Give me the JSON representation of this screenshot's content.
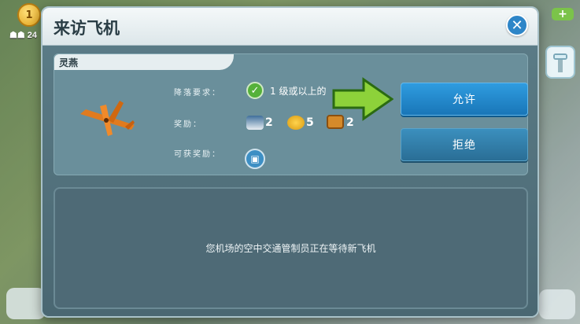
{
  "hud": {
    "level": "1",
    "people_count": "24",
    "plus_icon": "plus-icon"
  },
  "dialog": {
    "title": "来访飞机",
    "close_icon": "close-icon"
  },
  "request": {
    "plane_name": "灵燕",
    "landing_label": "降落要求：",
    "landing_requirement": "1 级或以上的",
    "reward_label": "奖励：",
    "rewards": [
      {
        "icon": "pilot-cap-icon",
        "value": "2"
      },
      {
        "icon": "coins-icon",
        "value": "5"
      },
      {
        "icon": "crate-icon",
        "value": "2"
      }
    ],
    "bonus_label": "可获奖励：",
    "bonus_icon": "gift-box-icon"
  },
  "actions": {
    "allow_label": "允许",
    "reject_label": "拒绝"
  },
  "status_message": "您机场的空中交通管制员正在等待新飞机",
  "colors": {
    "allow_button": "#1f86c9",
    "reject_button": "#2f7ba8",
    "check": "#55b13a",
    "pointer_arrow": "#8dd23a"
  }
}
